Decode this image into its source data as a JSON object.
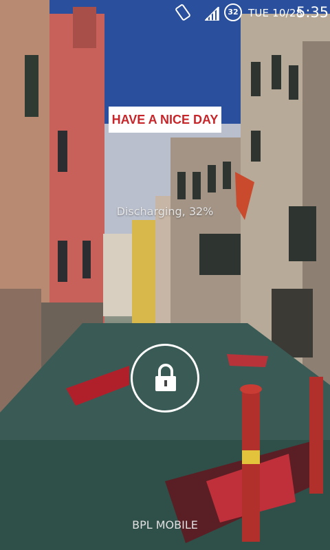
{
  "status_bar": {
    "battery_level": "32",
    "date": "TUE 10/28",
    "time": "5:35",
    "icons": [
      "rotate-icon",
      "signal-icon",
      "battery-icon"
    ]
  },
  "banner": {
    "text": "HAVE A NICE DAY"
  },
  "lockscreen": {
    "battery_status": "Discharging, 32%",
    "carrier": "BPL MOBILE",
    "lock_icon": "lock-icon"
  },
  "colors": {
    "banner_text": "#c6262a",
    "banner_bg": "#ffffff",
    "text": "#ffffff"
  }
}
